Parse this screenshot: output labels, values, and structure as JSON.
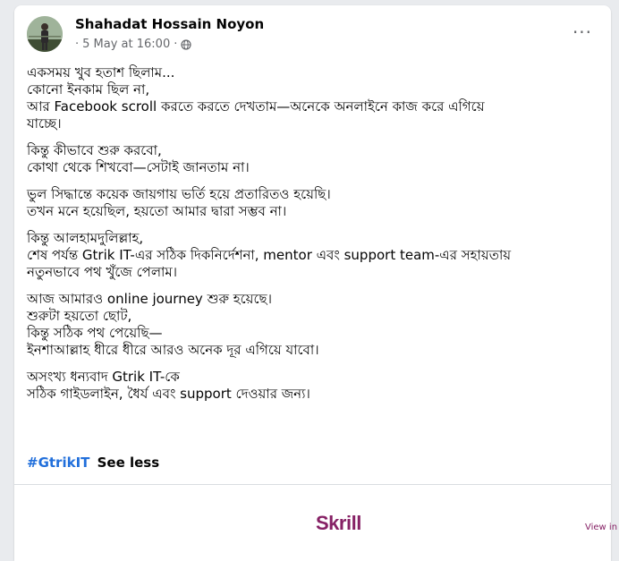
{
  "post": {
    "author": "Shahadat Hossain Noyon",
    "date": "5 May at 16:00",
    "separator": "·",
    "privacy_icon": "globe-icon",
    "more_label": "···",
    "paragraphs": [
      [
        "একসময় খুব হতাশ ছিলাম...",
        "কোনো ইনকাম ছিল না,",
        "আর Facebook scroll করতে করতে দেখতাম—অনেকে অনলাইনে কাজ করে এগিয়ে",
        "যাচ্ছে।"
      ],
      [
        "কিন্তু কীভাবে শুরু করবো,",
        "কোথা থেকে শিখবো—সেটাই জানতাম না।"
      ],
      [
        "ভুল সিদ্ধান্তে কয়েক জায়গায় ভর্তি হয়ে প্রতারিতও হয়েছি।",
        "তখন মনে হয়েছিল, হয়তো আমার দ্বারা সম্ভব না।"
      ],
      [
        "কিন্তু আলহামদুলিল্লাহ,",
        "শেষ পর্যন্ত Gtrik IT-এর সঠিক দিকনির্দেশনা, mentor এবং support team-এর সহায়তায়",
        "নতুনভাবে পথ খুঁজে পেলাম।"
      ],
      [
        "আজ আমারও online journey শুরু হয়েছে।",
        "শুরুটা হয়তো ছোট,",
        "কিন্তু সঠিক পথ পেয়েছি—",
        "ইনশাআল্লাহ ধীরে ধীরে আরও অনেক দূর এগিয়ে যাবো।"
      ],
      [
        "অসংখ্য ধন্যবাদ Gtrik IT-কে",
        "সঠিক গাইডলাইন, ধৈর্য এবং support দেওয়ার জন্য।"
      ]
    ],
    "hashtag": "#GtrikIT",
    "see_less": "See less"
  },
  "ad": {
    "brand": "Skrill",
    "view_in": "View in"
  },
  "colors": {
    "hashtag": "#216fdb",
    "skrill": "#862165",
    "meta": "#65676b"
  }
}
